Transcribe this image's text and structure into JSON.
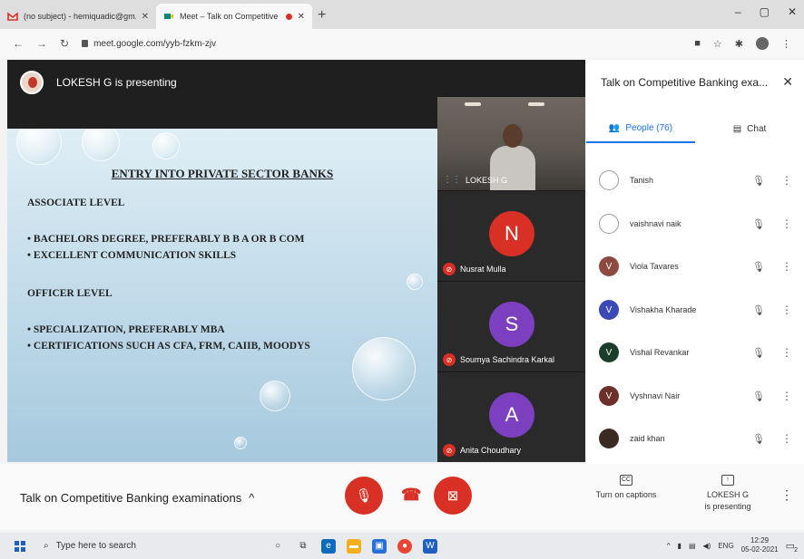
{
  "browser": {
    "tabs": [
      {
        "title": "(no subject) - hemiquadic@gm...",
        "active": false
      },
      {
        "title": "Meet – Talk on Competitive",
        "active": true
      }
    ],
    "url": "meet.google.com/yyb-fzkm-zjv"
  },
  "meet": {
    "presenter_banner": "LOKESH G is presenting",
    "slide": {
      "title": "ENTRY INTO PRIVATE SECTOR BANKS",
      "section1": "ASSOCIATE LEVEL",
      "bullets1": [
        "• BACHELORS DEGREE, PREFERABLY B B A OR B COM",
        "• EXCELLENT COMMUNICATION SKILLS"
      ],
      "section2": "OFFICER LEVEL",
      "bullets2": [
        "• SPECIALIZATION, PREFERABLY MBA",
        "• CERTIFICATIONS SUCH AS CFA, FRM, CAIIB, MOODYS"
      ]
    },
    "tiles": [
      {
        "name": "LOKESH G",
        "type": "video"
      },
      {
        "name": "Nusrat Mulla",
        "initial": "N",
        "color": "#d93025"
      },
      {
        "name": "Soumya Sachindra Karkal",
        "initial": "S",
        "color": "#7b3fbf"
      },
      {
        "name": "Anita Choudhary",
        "initial": "A",
        "color": "#7b3fbf"
      }
    ]
  },
  "panel": {
    "title": "Talk on Competitive Banking exa...",
    "tab_people": "People (76)",
    "tab_chat": "Chat",
    "people": [
      {
        "name": "Tanish",
        "initial": "",
        "color": "#ffffff"
      },
      {
        "name": "vaishnavi naik",
        "initial": "",
        "color": "#ffffff"
      },
      {
        "name": "Viola Tavares",
        "initial": "V",
        "color": "#8d4a3f"
      },
      {
        "name": "Vishakha Kharade",
        "initial": "V",
        "color": "#3a49b5"
      },
      {
        "name": "Vishal Revankar",
        "initial": "V",
        "color": "#1d3d2c"
      },
      {
        "name": "Vyshnavi Nair",
        "initial": "V",
        "color": "#6d2f2a"
      },
      {
        "name": "zaid khan",
        "initial": "",
        "color": "#3b2a22"
      }
    ]
  },
  "bottom": {
    "meeting_title": "Talk on Competitive Banking examinations",
    "captions_icon_label": "CC",
    "captions_label": "Turn on captions",
    "presenting_name": "LOKESH G",
    "presenting_label": "is presenting"
  },
  "taskbar": {
    "search_placeholder": "Type here to search",
    "lang": "ENG",
    "time": "12:29",
    "date": "05-02-2021",
    "notification_count": "2"
  }
}
